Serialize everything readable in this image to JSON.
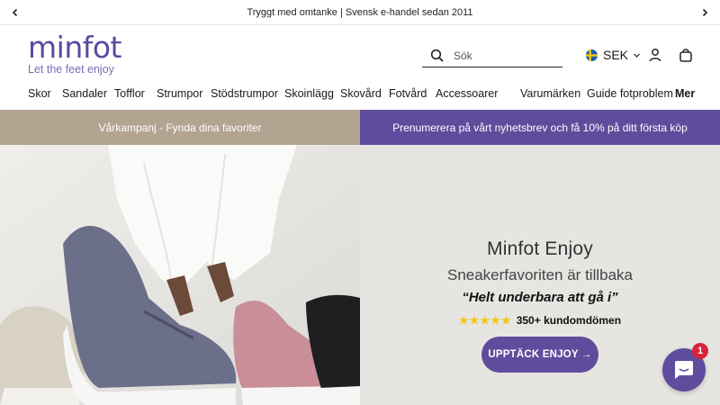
{
  "announcement": {
    "text": "Tryggt med omtanke | Svensk e-handel sedan 2011",
    "prev_icon": "chevron-left-icon",
    "next_icon": "chevron-right-icon"
  },
  "header": {
    "logo_text": "minfot",
    "logo_tagline": "Let the feet enjoy",
    "search_placeholder": "Sök",
    "currency": "SEK",
    "flag": "sweden-flag-icon",
    "icons": [
      "search-icon",
      "user-icon",
      "shopping-bag-icon"
    ]
  },
  "nav": {
    "items": [
      "Skor",
      "Sandaler",
      "Tofflor",
      "Strumpor",
      "Stödstrumpor",
      "Skoinlägg",
      "Skovård",
      "Fotvård",
      "Accessoarer",
      "Varumärken",
      "Guide fotproblem",
      "Mer"
    ]
  },
  "promo": {
    "left": "Vårkampanj - Fynda dina favoriter",
    "right": "Prenumerera på vårt nyhetsbrev och få 10% på ditt första köp"
  },
  "hero": {
    "title": "Minfot Enjoy",
    "subtitle": "Sneakerfavoriten är tillbaka",
    "quote": "“Helt underbara att gå i”",
    "rating_stars": 5,
    "reviews": "350+ kundomdömen",
    "cta": "UPPTÄCK ENJOY →"
  },
  "chat": {
    "badge": "1",
    "icon": "chat-icon"
  },
  "colors": {
    "brand_purple": "#5e4d9c",
    "promo_beige": "#b3a391",
    "hero_bg": "#e6e5e2",
    "star_yellow": "#f5c518",
    "badge_red": "#d8233a"
  }
}
